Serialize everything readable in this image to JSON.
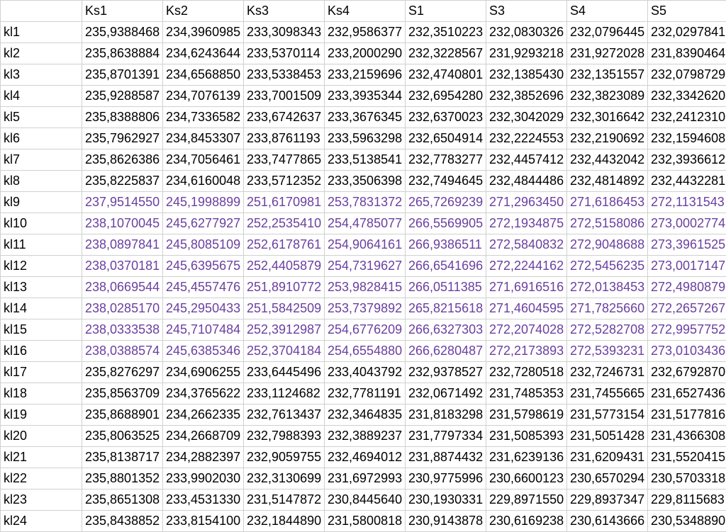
{
  "chart_data": {
    "type": "table",
    "title": "",
    "columns": [
      "Ks1",
      "Ks2",
      "Ks3",
      "Ks4",
      "S1",
      "S3",
      "S4",
      "S5"
    ],
    "row_labels": [
      "kl1",
      "kl2",
      "kl3",
      "kl4",
      "kl5",
      "kl6",
      "kl7",
      "kl8",
      "kl9",
      "kl10",
      "kl11",
      "kl12",
      "kl13",
      "kl14",
      "kl15",
      "kl16",
      "kl17",
      "kl18",
      "kl19",
      "kl20",
      "kl21",
      "kl22",
      "kl23",
      "kl24"
    ],
    "purple_rows": [
      "kl9",
      "kl10",
      "kl11",
      "kl12",
      "kl13",
      "kl14",
      "kl15",
      "kl16"
    ],
    "data": {
      "kl1": [
        "235,9388468",
        "234,3960985",
        "233,3098343",
        "232,9586377",
        "232,3510223",
        "232,0830326",
        "232,0796445",
        "232,0297841"
      ],
      "kl2": [
        "235,8638884",
        "234,6243644",
        "233,5370114",
        "233,2000290",
        "232,3228567",
        "231,9293218",
        "231,9272028",
        "231,8390464"
      ],
      "kl3": [
        "235,8701391",
        "234,6568850",
        "233,5338453",
        "233,2159696",
        "232,4740801",
        "232,1385430",
        "232,1351557",
        "232,0798729"
      ],
      "kl4": [
        "235,9288587",
        "234,7076139",
        "233,7001509",
        "233,3935344",
        "232,6954280",
        "232,3852696",
        "232,3823089",
        "232,3342620"
      ],
      "kl5": [
        "235,8388806",
        "234,7336582",
        "233,6742637",
        "233,3676345",
        "232,6370023",
        "232,3042029",
        "232,3016642",
        "232,2412310"
      ],
      "kl6": [
        "235,7962927",
        "234,8453307",
        "233,8761193",
        "233,5963298",
        "232,6504914",
        "232,2224553",
        "232,2190692",
        "232,1594608"
      ],
      "kl7": [
        "235,8626386",
        "234,7056461",
        "233,7477865",
        "233,5138541",
        "232,7783277",
        "232,4457412",
        "232,4432042",
        "232,3936612"
      ],
      "kl8": [
        "235,8225837",
        "234,6160048",
        "233,5712352",
        "233,3506398",
        "232,7494645",
        "232,4844486",
        "232,4814892",
        "232,4432281"
      ],
      "kl9": [
        "237,9514550",
        "245,1998899",
        "251,6170981",
        "253,7831372",
        "265,7269239",
        "271,2963450",
        "271,6186453",
        "272,1131543"
      ],
      "kl10": [
        "238,1070045",
        "245,6277927",
        "252,2535410",
        "254,4785077",
        "266,5569905",
        "272,1934875",
        "272,5158086",
        "273,0002774"
      ],
      "kl11": [
        "238,0897841",
        "245,8085109",
        "252,6178761",
        "254,9064161",
        "266,9386511",
        "272,5840832",
        "272,9048688",
        "273,3961525"
      ],
      "kl12": [
        "238,0370181",
        "245,6395675",
        "252,4405879",
        "254,7319627",
        "266,6541696",
        "272,2244162",
        "272,5456235",
        "273,0017147"
      ],
      "kl13": [
        "238,0669544",
        "245,4557476",
        "251,8910772",
        "253,9828415",
        "266,0511385",
        "271,6916516",
        "272,0138453",
        "272,4980879"
      ],
      "kl14": [
        "238,0285170",
        "245,2950433",
        "251,5842509",
        "253,7379892",
        "265,8215618",
        "271,4604595",
        "271,7825660",
        "272,2657267"
      ],
      "kl15": [
        "238,0333538",
        "245,7107484",
        "252,3912987",
        "254,6776209",
        "266,6327303",
        "272,2074028",
        "272,5282708",
        "272,9957752"
      ],
      "kl16": [
        "238,0388574",
        "245,6385346",
        "252,3704184",
        "254,6554880",
        "266,6280487",
        "272,2173893",
        "272,5393231",
        "273,0103436"
      ],
      "kl17": [
        "235,8276297",
        "234,6906255",
        "233,6445496",
        "233,4043792",
        "232,9378527",
        "232,7280518",
        "232,7246731",
        "232,6792870"
      ],
      "kl18": [
        "235,8563709",
        "234,3765622",
        "233,1124682",
        "232,7781191",
        "232,0671492",
        "231,7485353",
        "231,7455665",
        "231,6527436"
      ],
      "kl19": [
        "235,8688901",
        "234,2662335",
        "232,7613437",
        "232,3464835",
        "231,8183298",
        "231,5798619",
        "231,5773154",
        "231,5177816"
      ],
      "kl20": [
        "235,8063525",
        "234,2668709",
        "232,7988393",
        "232,3889237",
        "231,7797334",
        "231,5085393",
        "231,5051428",
        "231,4366308"
      ],
      "kl21": [
        "235,8138717",
        "234,2882397",
        "232,9059755",
        "232,4694012",
        "231,8874432",
        "231,6239136",
        "231,6209431",
        "231,5520415"
      ],
      "kl22": [
        "235,8801352",
        "233,9902030",
        "232,3130699",
        "231,6972993",
        "230,9775996",
        "230,6600123",
        "230,6570294",
        "230,5703318"
      ],
      "kl23": [
        "235,8651308",
        "233,4531330",
        "231,5147872",
        "230,8445640",
        "230,1930331",
        "229,8971550",
        "229,8937347",
        "229,8115683"
      ],
      "kl24": [
        "235,8438852",
        "233,8154100",
        "232,1844890",
        "231,5800818",
        "230,9143878",
        "230,6169238",
        "230,6143666",
        "230,5348890"
      ]
    }
  }
}
